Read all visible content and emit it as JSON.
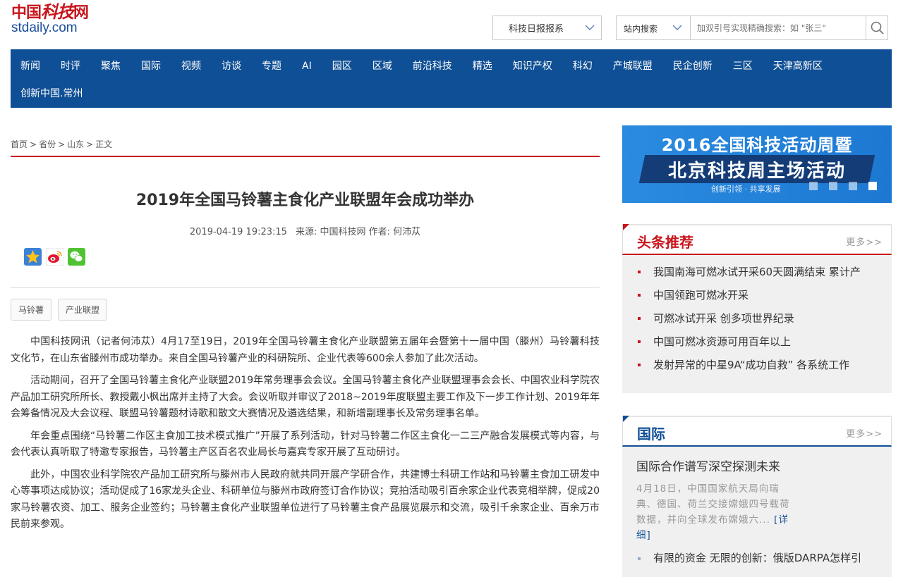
{
  "logo": {
    "cn_part1": "中国",
    "cn_part2": "科技",
    "cn_part3": "网",
    "en": "stdaily.com"
  },
  "paper_select": {
    "label": "科技日报报系",
    "icon": "chevron-down-icon"
  },
  "search": {
    "scope": "站内搜索",
    "placeholder": "加双引号实现精确搜索：如 \"张三\"",
    "icon": "search-icon"
  },
  "nav": {
    "row1": [
      "新闻",
      "时评",
      "聚焦",
      "国际",
      "视频",
      "访谈",
      "专题",
      "AI",
      "园区",
      "区域",
      "前沿科技",
      "精选",
      "知识产权",
      "科幻",
      "产城联盟",
      "民企创新",
      "三区",
      "天津高新区"
    ],
    "row2": [
      "创新中国.常州"
    ]
  },
  "breadcrumb": [
    "首页",
    "省份",
    "山东",
    "正文"
  ],
  "article": {
    "title": "2019年全国马铃薯主食化产业联盟年会成功举办",
    "datetime": "2019-04-19 19:23:15",
    "source": "来源: 中国科技网",
    "author": "作者: 何沛苁",
    "tags": [
      "马铃薯",
      "产业联盟"
    ],
    "paragraphs": [
      "中国科技网讯（记者何沛苁）4月17至19日，2019年全国马铃薯主食化产业联盟第五届年会暨第十一届中国（滕州）马铃薯科技文化节，在山东省滕州市成功举办。来自全国马铃薯产业的科研院所、企业代表等600余人参加了此次活动。",
      "活动期间，召开了全国马铃薯主食化产业联盟2019年常务理事会会议。全国马铃薯主食化产业联盟理事会会长、中国农业科学院农产品加工研究所所长、教授戴小枫出席并主持了大会。会议听取并审议了2018~2019年度联盟主要工作及下一步工作计划、2019年年会筹备情况及大会议程、联盟马铃薯题材诗歌和散文大赛情况及遴选结果，和新增副理事长及常务理事名单。",
      "年会重点围绕“马铃薯二作区主食加工技术模式推广”开展了系列活动，针对马铃薯二作区主食化一二三产融合发展模式等内容，与会代表认真听取了特邀专家报告，马铃薯主产区百名农业局长与嘉宾专家开展了互动研讨。",
      "此外，中国农业科学院农产品加工研究所与滕州市人民政府就共同开展产学研合作，共建博士科研工作站和马铃薯主食加工研发中心等事项达成协议；活动促成了16家龙头企业、科研单位与滕州市政府签订合作协议；竞拍活动吸引百余家企业代表竞相举牌，促成20家马铃薯农资、加工、服务企业签约；马铃薯主食化产业联盟单位进行了马铃薯主食产品展览展示和交流，吸引千余家企业、百余万市民前来参观。"
    ]
  },
  "banner": {
    "line1": "2016全国科技活动周暨",
    "line2": "北京科技周主场活动",
    "line3": "创新引领 · 共享发展"
  },
  "headline_panel": {
    "title": "头条推荐",
    "more": "更多>>",
    "items": [
      "我国南海可燃冰试开采60天圆满结束 累计产",
      "中国领跑可燃冰开采",
      "可燃冰试开采 创多项世界纪录",
      "中国可燃冰资源可用百年以上",
      "发射异常的中星9A“成功自救” 各系统工作"
    ]
  },
  "intl_panel": {
    "title": "国际",
    "more": "更多>>",
    "lead_title": "国际合作谱写深空探测未来",
    "lead_text": "4月18日，中国国家航天局向瑞典、德国、荷兰交接嫦娥四号载荷数据，并向全球发布嫦娥六...",
    "detail": "[详细]",
    "item": "有限的资金 无限的创新：俄版DARPA怎样引"
  },
  "colors": {
    "nav_bg": "#0f4f95",
    "accent_red": "#c8161d",
    "panel_bg": "#f0f0f0"
  }
}
